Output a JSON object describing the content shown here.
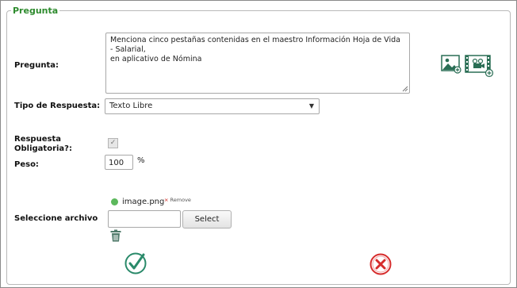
{
  "legend": "Pregunta",
  "fields": {
    "pregunta_label": "Pregunta:",
    "pregunta_value_line1": "Menciona cinco pestañas contenidas en el maestro Información Hoja de Vida - Salarial,",
    "pregunta_value_line2": "en aplicativo de Nómina",
    "tipo_label": "Tipo de Respuesta:",
    "tipo_value": "Texto Libre",
    "obligatoria_label_line1": "Respuesta",
    "obligatoria_label_line2": "Obligatoria?:",
    "peso_label": "Peso:",
    "peso_value": "100",
    "peso_unit": "%",
    "archivo_label": "Seleccione archivo",
    "file_name": "image.png",
    "remove_label": "Remove",
    "select_button": "Select"
  },
  "icons": {
    "add_image": "add-image-icon",
    "add_video": "add-video-icon",
    "trash": "trash-icon",
    "accept": "check-circle-icon",
    "cancel": "x-circle-icon"
  },
  "colors": {
    "legend": "#2e8b2e",
    "accept": "#2a8a6a",
    "cancel": "#d62b2b",
    "file_status": "#5cb85c",
    "remove_x": "#d9534f"
  }
}
